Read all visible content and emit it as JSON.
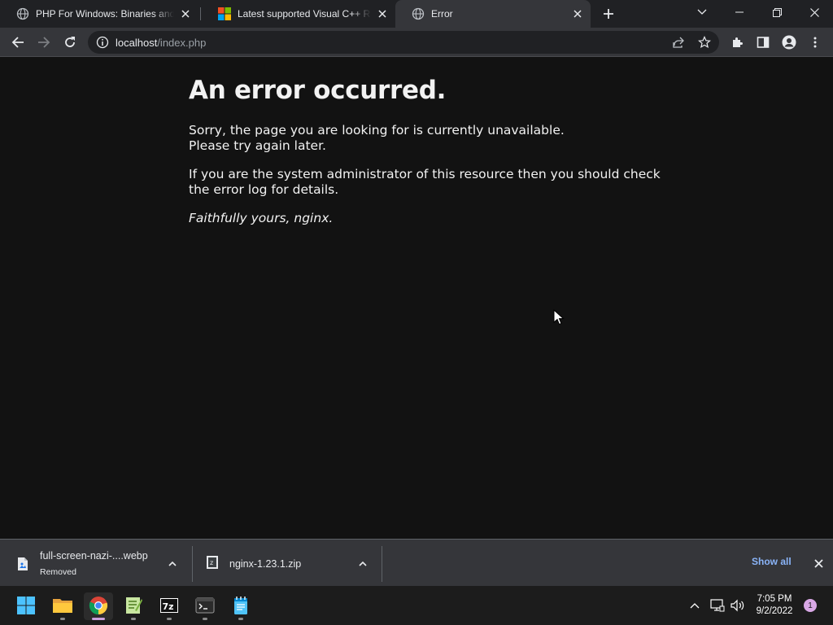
{
  "tabs": [
    {
      "title": "PHP For Windows: Binaries and sources Releases",
      "favicon": "globe-icon",
      "active": false
    },
    {
      "title": "Latest supported Visual C++ Redistributable downloads",
      "favicon": "microsoft-logo-icon",
      "active": false
    },
    {
      "title": "Error",
      "favicon": "globe-icon",
      "active": true
    }
  ],
  "address_bar": {
    "host": "localhost",
    "path": "/index.php"
  },
  "page": {
    "heading": "An error occurred.",
    "para1_line1": "Sorry, the page you are looking for is currently unavailable.",
    "para1_line2": "Please try again later.",
    "para2": "If you are the system administrator of this resource then you should check the error log for details.",
    "signature": "Faithfully yours, nginx."
  },
  "downloads": {
    "items": [
      {
        "name": "full-screen-nazi-....webp",
        "status": "Removed"
      },
      {
        "name": "nginx-1.23.1.zip",
        "status": ""
      }
    ],
    "show_all_label": "Show all"
  },
  "taskbar": {
    "apps": [
      "start-icon",
      "file-explorer-icon",
      "chrome-icon",
      "notepad-plus-plus-icon",
      "7zip-icon",
      "terminal-icon",
      "notepad-icon"
    ],
    "time": "7:05 PM",
    "date": "9/2/2022",
    "notification_count": "1"
  },
  "colors": {
    "accent_link": "#8ab4f8",
    "page_bg": "#121212",
    "toolbar_bg": "#35363a",
    "tabstrip_bg": "#202124"
  }
}
